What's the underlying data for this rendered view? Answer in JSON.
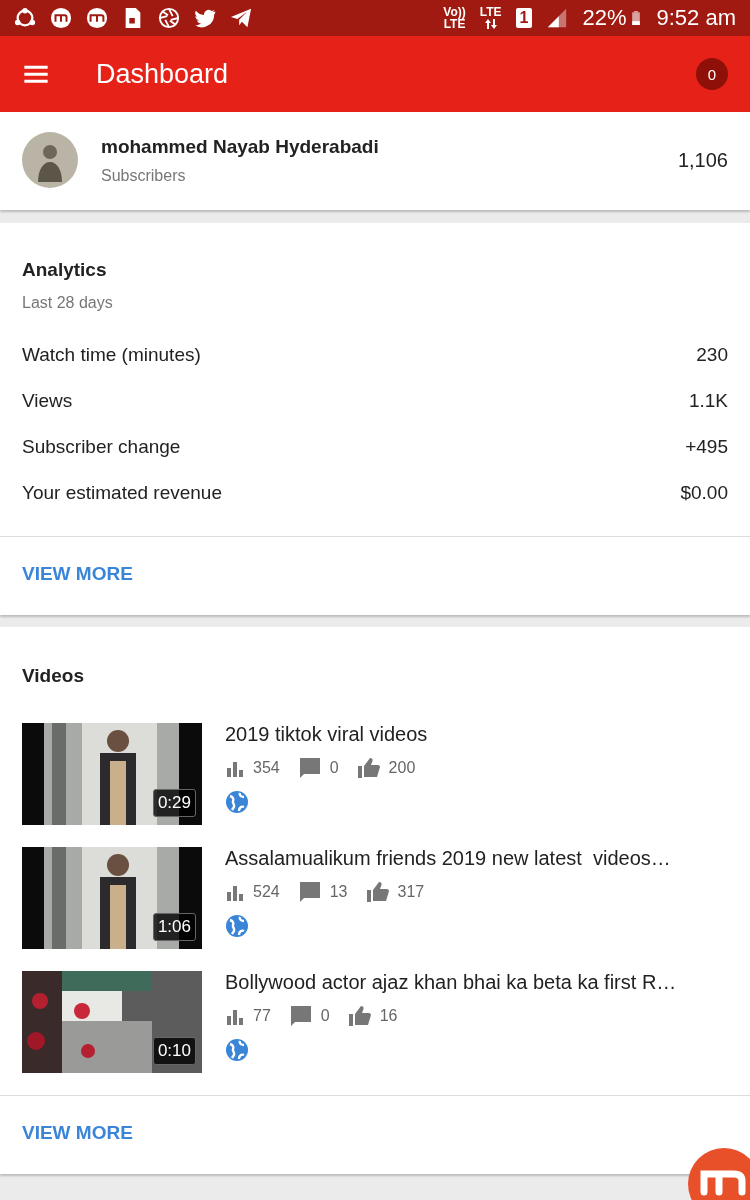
{
  "status_bar": {
    "volte": "Vo))",
    "volte_sub": "LTE",
    "network": "LTE",
    "sim": "1",
    "battery": "22%",
    "time": "9:52 am"
  },
  "app_bar": {
    "title": "Dashboard",
    "notifications": "0"
  },
  "channel": {
    "name": "mohammed Nayab Hyderabadi",
    "label": "Subscribers",
    "count": "1,106"
  },
  "analytics": {
    "title": "Analytics",
    "period": "Last 28 days",
    "rows": [
      {
        "label": "Watch time (minutes)",
        "value": "230"
      },
      {
        "label": "Views",
        "value": "1.1K"
      },
      {
        "label": "Subscriber change",
        "value": "+495"
      },
      {
        "label": "Your estimated revenue",
        "value": "$0.00"
      }
    ],
    "action": "VIEW MORE"
  },
  "videos": {
    "title": "Videos",
    "items": [
      {
        "title": "2019 tiktok viral videos",
        "duration": "0:29",
        "views": "354",
        "comments": "0",
        "likes": "200"
      },
      {
        "title": "Assalamualikum friends 2019 new latest  videos…",
        "duration": "1:06",
        "views": "524",
        "comments": "13",
        "likes": "317"
      },
      {
        "title": "Bollywood actor ajaz khan bhai ka beta ka first R…",
        "duration": "0:10",
        "views": "77",
        "comments": "0",
        "likes": "16"
      }
    ],
    "action": "VIEW MORE"
  }
}
